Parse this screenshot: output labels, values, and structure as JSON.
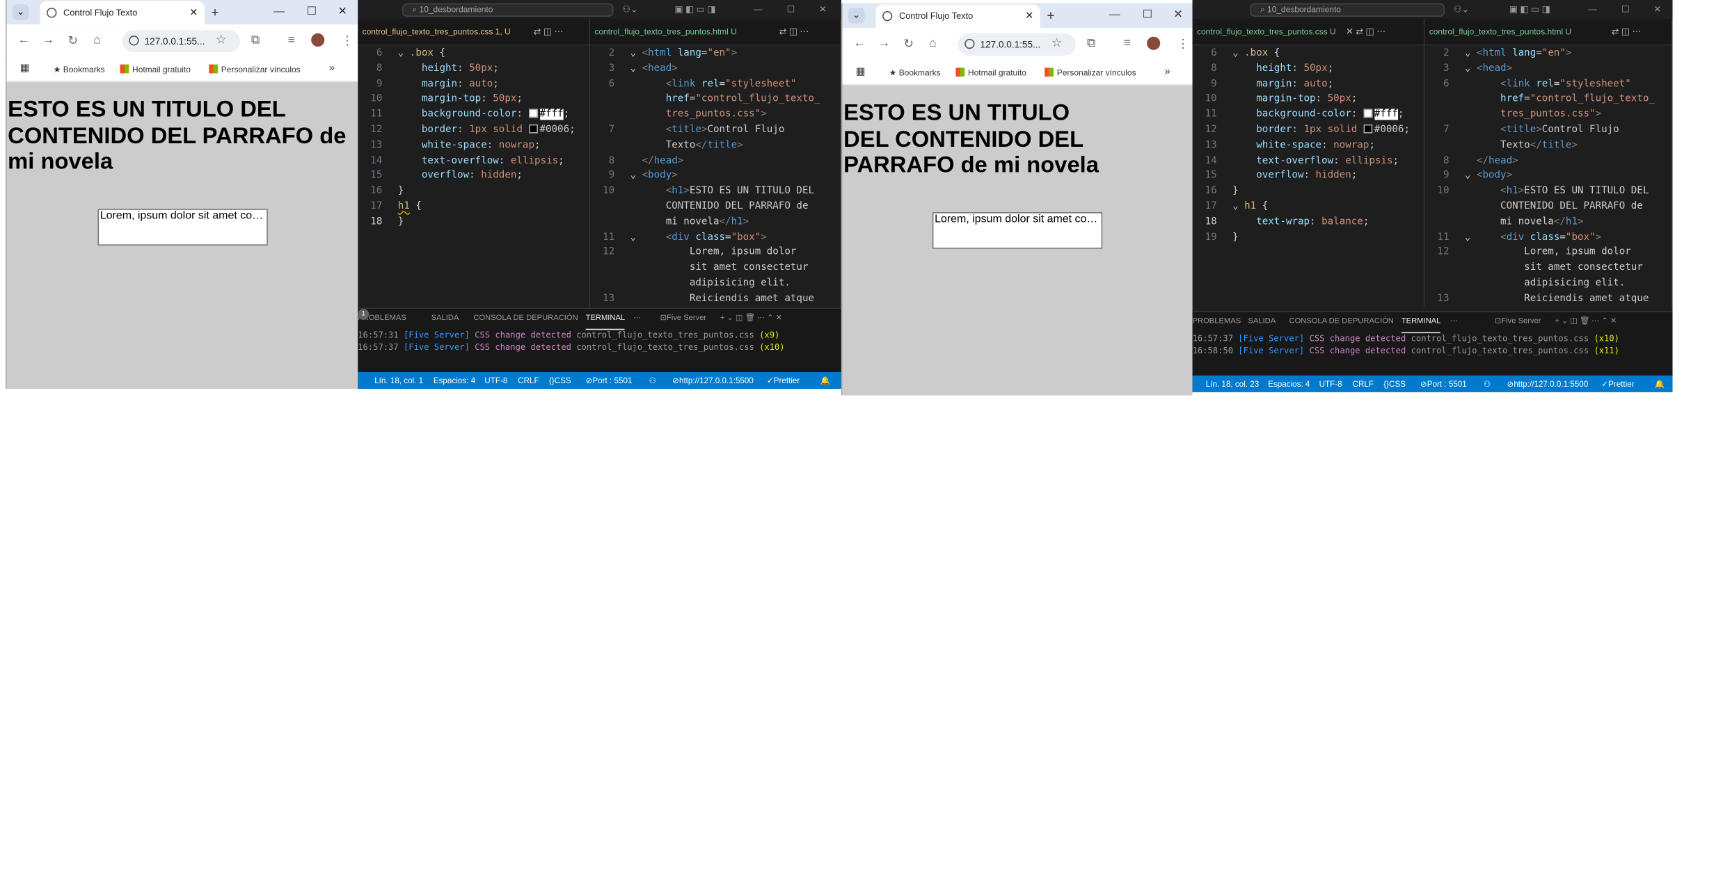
{
  "browser": {
    "tab_title": "Control Flujo Texto",
    "url": "127.0.0.1:55...",
    "bookmarks": [
      "Bookmarks",
      "Hotmail gratuito",
      "Personalizar vínculos"
    ],
    "heading_left": "ESTO ES UN TITULO DEL CONTENIDO DEL PARRAFO de mi novela",
    "heading_right": "ESTO ES UN TITULO DEL CONTENIDO DEL PARRAFO de mi novela",
    "box_text": "Lorem, ipsum dolor sit amet consectetur adipisicing elit."
  },
  "vscode": {
    "search": "10_desbordamiento",
    "css_tab_left": "control_flujo_texto_tres_puntos.css 1, U",
    "css_tab_right": "control_flujo_texto_tres_puntos.css U",
    "html_tab": "control_flujo_texto_tres_puntos.html U",
    "panel_tabs": [
      "PROBLEMAS",
      "SALIDA",
      "CONSOLA DE DEPURACIÓN",
      "TERMINAL"
    ],
    "problems_count": "1",
    "five_server": "Five Server",
    "terminal_left": [
      {
        "time": "16:57:31",
        "file": "control_flujo_texto_tres_puntos.css",
        "count": "(x9)"
      },
      {
        "time": "16:57:37",
        "file": "control_flujo_texto_tres_puntos.css",
        "count": "(x10)"
      }
    ],
    "terminal_right": [
      {
        "time": "16:57:37",
        "file": "control_flujo_texto_tres_puntos.css",
        "count": "(x10)"
      },
      {
        "time": "16:58:50",
        "file": "control_flujo_texto_tres_puntos.css",
        "count": "(x11)"
      }
    ],
    "server_tag": "[Five Server]",
    "css_change": "CSS change detected",
    "status_left": {
      "pos": "Lín. 18, col. 1",
      "spaces": "Espacios: 4",
      "enc": "UTF-8",
      "eol": "CRLF",
      "lang": "CSS",
      "port": "Port : 5501",
      "url": "http://127.0.0.1:5500",
      "prettier": "Prettier"
    },
    "status_right": {
      "pos": "Lín. 18, col. 23",
      "spaces": "Espacios: 4",
      "enc": "UTF-8",
      "eol": "CRLF",
      "lang": "CSS",
      "port": "Port : 5501",
      "url": "http://127.0.0.1:5500",
      "prettier": "Prettier"
    }
  }
}
